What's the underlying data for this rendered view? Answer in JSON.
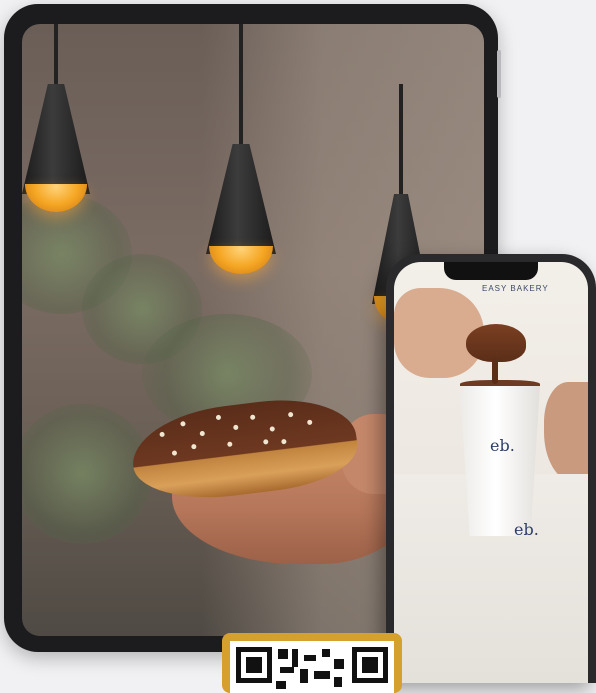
{
  "phone": {
    "brand_name": "EASY BAKERY",
    "cup_logo": "eb.",
    "floor_logo": "eb."
  },
  "icons": {
    "qr_code": "qr-code-icon"
  },
  "colors": {
    "brand_navy": "#2d3f66",
    "qr_gold": "#d6a02f",
    "device_frame": "#1c1c1e"
  }
}
